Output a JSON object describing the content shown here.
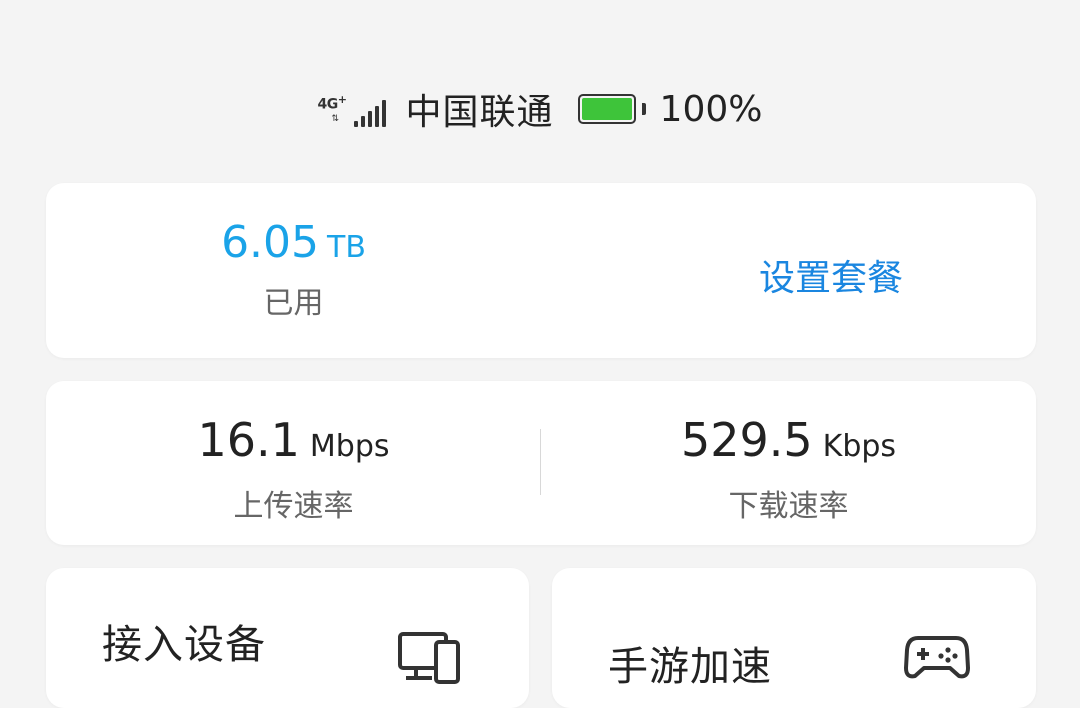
{
  "status_bar": {
    "network_type": "4G",
    "network_plus": "+",
    "carrier": "中国联通",
    "battery_percent": "100%",
    "battery_level": 1.0,
    "battery_color": "#3ec43a"
  },
  "usage_card": {
    "value": "6.05",
    "unit": "TB",
    "label": "已用",
    "plan_link": "设置套餐",
    "accent_color": "#1aa3e8"
  },
  "speed_card": {
    "upload": {
      "value": "16.1",
      "unit": "Mbps",
      "label": "上传速率"
    },
    "download": {
      "value": "529.5",
      "unit": "Kbps",
      "label": "下载速率"
    }
  },
  "tiles": {
    "devices": {
      "title": "接入设备",
      "icon": "devices-icon"
    },
    "game": {
      "title": "手游加速",
      "icon": "gamepad-icon"
    }
  }
}
